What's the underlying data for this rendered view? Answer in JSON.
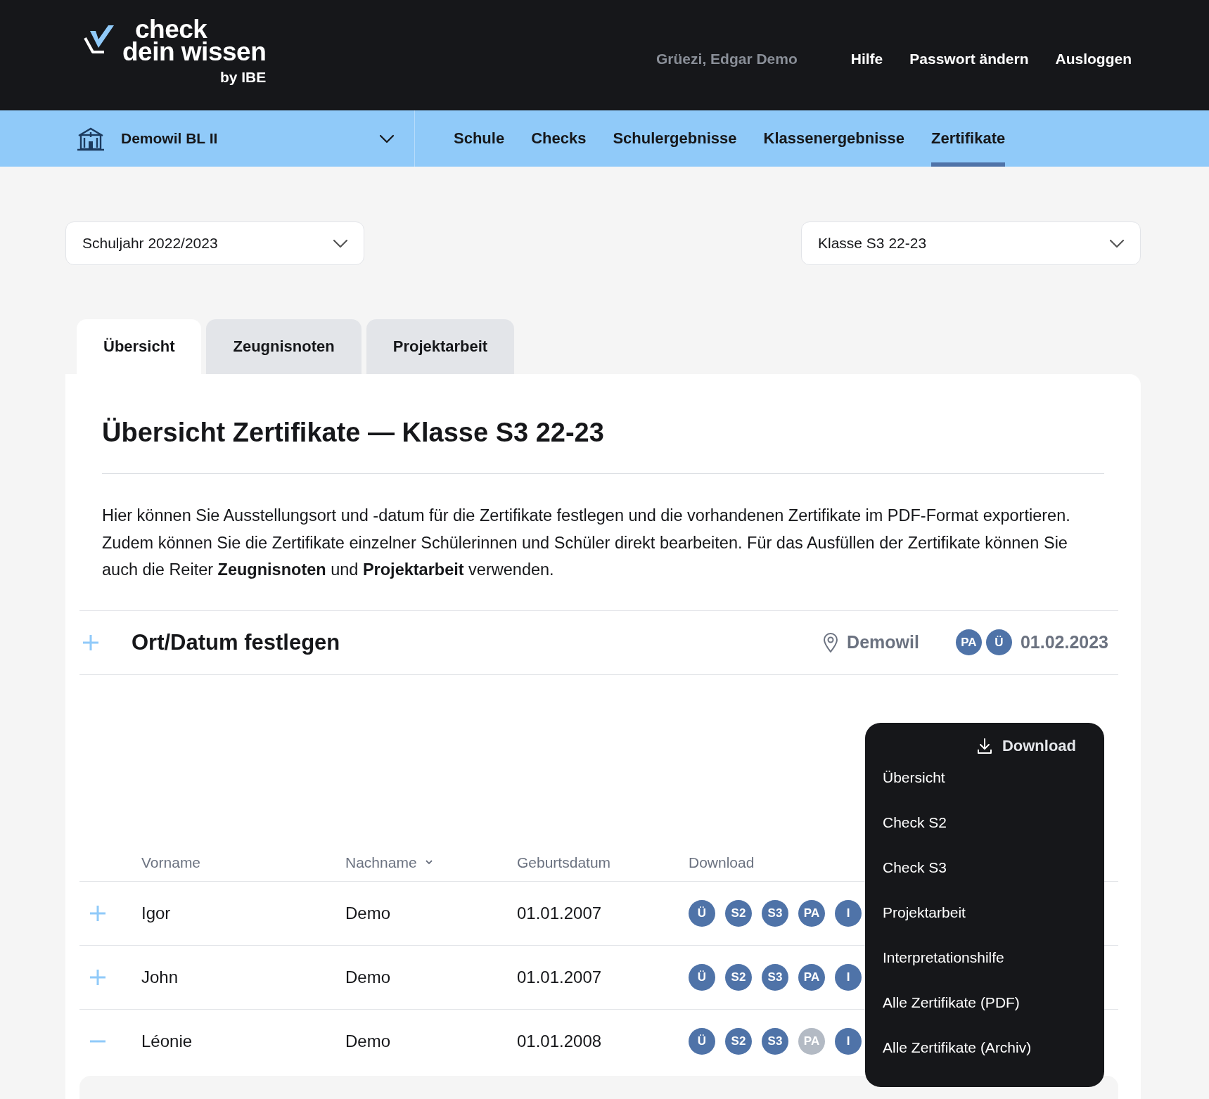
{
  "logo": {
    "lines": [
      "check",
      "dein wissen"
    ],
    "byline": "by IBE"
  },
  "header": {
    "greeting": "Grüezi, Edgar Demo",
    "links": [
      "Hilfe",
      "Passwort ändern",
      "Ausloggen"
    ]
  },
  "school_select": {
    "value": "Demowil BL II"
  },
  "nav": [
    {
      "label": "Schule",
      "selected": false
    },
    {
      "label": "Checks",
      "selected": false
    },
    {
      "label": "Schulergebnisse",
      "selected": false
    },
    {
      "label": "Klassenergebnisse",
      "selected": false
    },
    {
      "label": "Zertifikate",
      "selected": true
    }
  ],
  "filters": [
    {
      "value": "Schuljahr 2022/2023"
    },
    {
      "value": "Klasse S3 22-23"
    }
  ],
  "tabs": [
    {
      "label": "Übersicht",
      "selected": true
    },
    {
      "label": "Zeugnisnoten",
      "selected": false
    },
    {
      "label": "Projektarbeit",
      "selected": false
    }
  ],
  "title": "Übersicht Zertifikate — Klasse S3 22-23",
  "intro": "Hier können Sie Ausstellungsort und -datum für die Zertifikate festlegen und die vorhandenen Zertifikate im PDF-Format exportieren. Zudem können Sie die Zertifikate einzelner Schülerinnen und Schüler direkt bearbeiten. Für das Ausfüllen der Zertifikate können Sie auch die Reiter **Zeugnisnoten** und **Projektarbeit** verwenden.",
  "place_date": {
    "label": "Ort/Datum festlegen",
    "expanded": false,
    "place": "Demowil",
    "badges": [
      "PA",
      "Ü"
    ],
    "date": "01.02.2023"
  },
  "table": {
    "columns": [
      {
        "label": "Vorname",
        "sortable": false
      },
      {
        "label": "Nachname",
        "sortable": true
      },
      {
        "label": "Geburtsdatum",
        "sortable": false
      },
      {
        "label": "Download",
        "sortable": false
      }
    ],
    "rows": [
      {
        "expanded": false,
        "first_name": "Igor",
        "last_name": "Demo",
        "birthdate": "01.01.2007",
        "downloads": [
          {
            "label": "Ü",
            "available": true
          },
          {
            "label": "S2",
            "available": true
          },
          {
            "label": "S3",
            "available": true
          },
          {
            "label": "PA",
            "available": true
          },
          {
            "label": "I",
            "available": true
          }
        ]
      },
      {
        "expanded": false,
        "first_name": "John",
        "last_name": "Demo",
        "birthdate": "01.01.2007",
        "downloads": [
          {
            "label": "Ü",
            "available": true
          },
          {
            "label": "S2",
            "available": true
          },
          {
            "label": "S3",
            "available": true
          },
          {
            "label": "PA",
            "available": true
          },
          {
            "label": "I",
            "available": true
          }
        ]
      },
      {
        "expanded": true,
        "first_name": "Léonie",
        "last_name": "Demo",
        "birthdate": "01.01.2008",
        "downloads": [
          {
            "label": "Ü",
            "available": true
          },
          {
            "label": "S2",
            "available": true
          },
          {
            "label": "S3",
            "available": true
          },
          {
            "label": "PA",
            "available": false
          },
          {
            "label": "I",
            "available": true
          }
        ]
      }
    ]
  },
  "download_menu": {
    "title": "Download",
    "items": [
      "Übersicht",
      "Check S2",
      "Check S3",
      "Projektarbeit",
      "Interpretationshilfe",
      "Alle Zertifikate (PDF)",
      "Alle Zertifikate (Archiv)"
    ]
  }
}
